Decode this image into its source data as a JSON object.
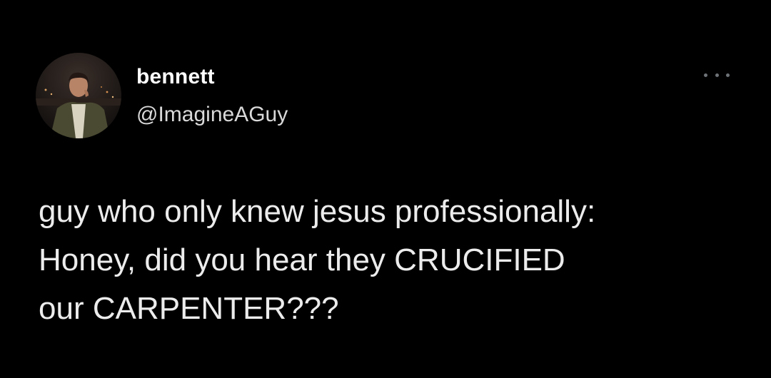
{
  "tweet": {
    "display_name": "bennett",
    "handle": "@ImagineAGuy",
    "avatar_icon": "profile-photo",
    "more_icon": "more-horizontal-icon",
    "text_lines": [
      "guy who only knew jesus professionally:",
      "Honey, did you hear they CRUCIFIED",
      "our CARPENTER???"
    ]
  },
  "colors": {
    "background": "#000000",
    "text": "#ffffff",
    "secondary": "#d9d9d9",
    "icon": "#6e7378"
  }
}
